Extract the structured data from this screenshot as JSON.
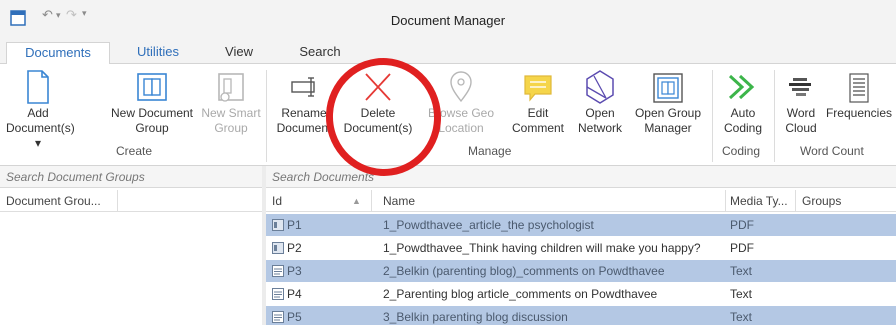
{
  "window": {
    "title": "Document Manager"
  },
  "quick_access": {
    "undo": "↶",
    "undo_drop": "▾",
    "redo": "↷",
    "customize": "▾"
  },
  "tabs": [
    {
      "label": "Documents",
      "active": true
    },
    {
      "label": "Utilities"
    },
    {
      "label": "View"
    },
    {
      "label": "Search"
    }
  ],
  "ribbon": {
    "add_documents": {
      "line1": "Add",
      "line2": "Document(s) ▾"
    },
    "new_document_group": {
      "line1": "New Document",
      "line2": "Group"
    },
    "new_smart_group": {
      "line1": "New Smart",
      "line2": "Group"
    },
    "create_label": "Create",
    "rename_document": {
      "line1": "Rename",
      "line2": "Document"
    },
    "delete_documents": {
      "line1": "Delete",
      "line2": "Document(s)"
    },
    "browse_geo_location": {
      "line1": "Browse Geo",
      "line2": "Location"
    },
    "edit_comment": {
      "line1": "Edit",
      "line2": "Comment"
    },
    "open_network": {
      "line1": "Open",
      "line2": "Network"
    },
    "open_group_manager": {
      "line1": "Open Group",
      "line2": "Manager"
    },
    "manage_label": "Manage",
    "auto_coding": {
      "line1": "Auto",
      "line2": "Coding"
    },
    "coding_label": "Coding",
    "word_cloud": {
      "line1": "Word",
      "line2": "Cloud"
    },
    "frequencies": {
      "line1": "Frequencies"
    },
    "word_count_label": "Word Count"
  },
  "left_pane": {
    "search_placeholder": "Search Document Groups",
    "column_header": "Document Grou..."
  },
  "right_pane": {
    "search_placeholder": "Search Documents",
    "columns": {
      "id": "Id",
      "sort": "▲",
      "name": "Name",
      "media_type": "Media Ty...",
      "groups": "Groups"
    },
    "rows": [
      {
        "id": "P1",
        "name": "1_Powdthavee_article_the psychologist",
        "media_type": "PDF",
        "selected": true
      },
      {
        "id": "P2",
        "name": "1_Powdthavee_Think having children will make you happy?",
        "media_type": "PDF",
        "selected": false
      },
      {
        "id": "P3",
        "name": "2_Belkin (parenting blog)_comments on Powdthavee",
        "media_type": "Text",
        "selected": true
      },
      {
        "id": "P4",
        "name": "2_Parenting blog article_comments on Powdthavee",
        "media_type": "Text",
        "selected": false
      },
      {
        "id": "P5",
        "name": "3_Belkin parenting blog discussion",
        "media_type": "Text",
        "selected": true
      }
    ]
  },
  "colors": {
    "accent": "#2f6fba",
    "selection": "#b4c8e4",
    "highlight_circle": "#e02020"
  }
}
